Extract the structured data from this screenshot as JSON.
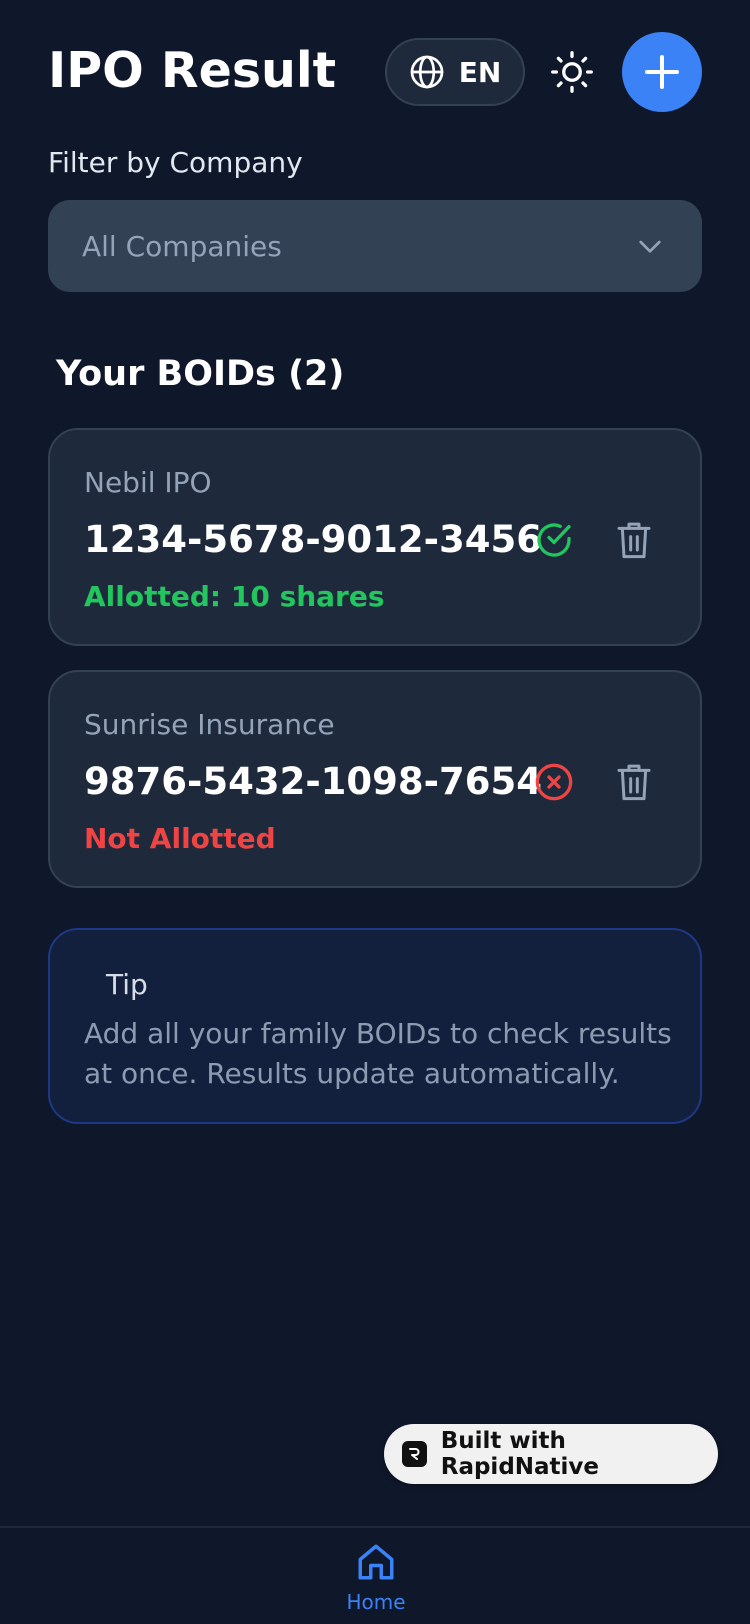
{
  "header": {
    "title": "IPO Result",
    "language_label": "EN",
    "language_icon": "globe-icon",
    "theme_icon": "sun-icon",
    "add_icon": "plus-icon"
  },
  "filter": {
    "label": "Filter by Company",
    "selected": "All Companies"
  },
  "boids": {
    "section_title": "Your BOIDs (2)",
    "items": [
      {
        "company": "Nebil IPO",
        "boid": "1234-5678-9012-3456",
        "status": "Allotted: 10 shares",
        "state": "allotted"
      },
      {
        "company": "Sunrise Insurance",
        "boid": "9876-5432-1098-7654",
        "status": "Not Allotted",
        "state": "not_allotted"
      }
    ]
  },
  "tip": {
    "title": "Tip",
    "body": "Add all your family BOIDs to check results at once. Results update automatically."
  },
  "badge": {
    "label": "Built with RapidNative"
  },
  "nav": {
    "home_label": "Home"
  },
  "colors": {
    "background": "#0f172a",
    "card": "#1e293b",
    "accent": "#3b82f6",
    "success": "#22c55e",
    "danger": "#ef4444"
  }
}
